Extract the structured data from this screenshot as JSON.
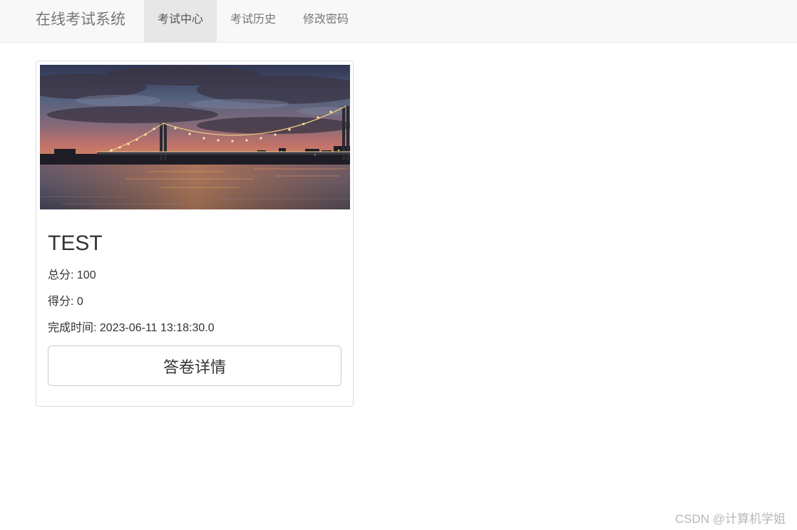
{
  "navbar": {
    "brand": "在线考试系统",
    "items": [
      {
        "label": "考试中心",
        "active": true
      },
      {
        "label": "考试历史",
        "active": false
      },
      {
        "label": "修改密码",
        "active": false
      }
    ]
  },
  "exam": {
    "title": "TEST",
    "total_score": "总分: 100",
    "score": "得分: 0",
    "finish_time": "完成时间: 2023-06-11 13:18:30.0",
    "detail_button": "答卷详情",
    "image": "bridge-night-photo"
  },
  "watermark": "CSDN @计算机学姐",
  "colors": {
    "navbar_bg": "#f8f8f8",
    "active_tab_bg": "#e7e7e7",
    "nav_text": "#777777",
    "text": "#333333",
    "border": "#dddddd"
  }
}
